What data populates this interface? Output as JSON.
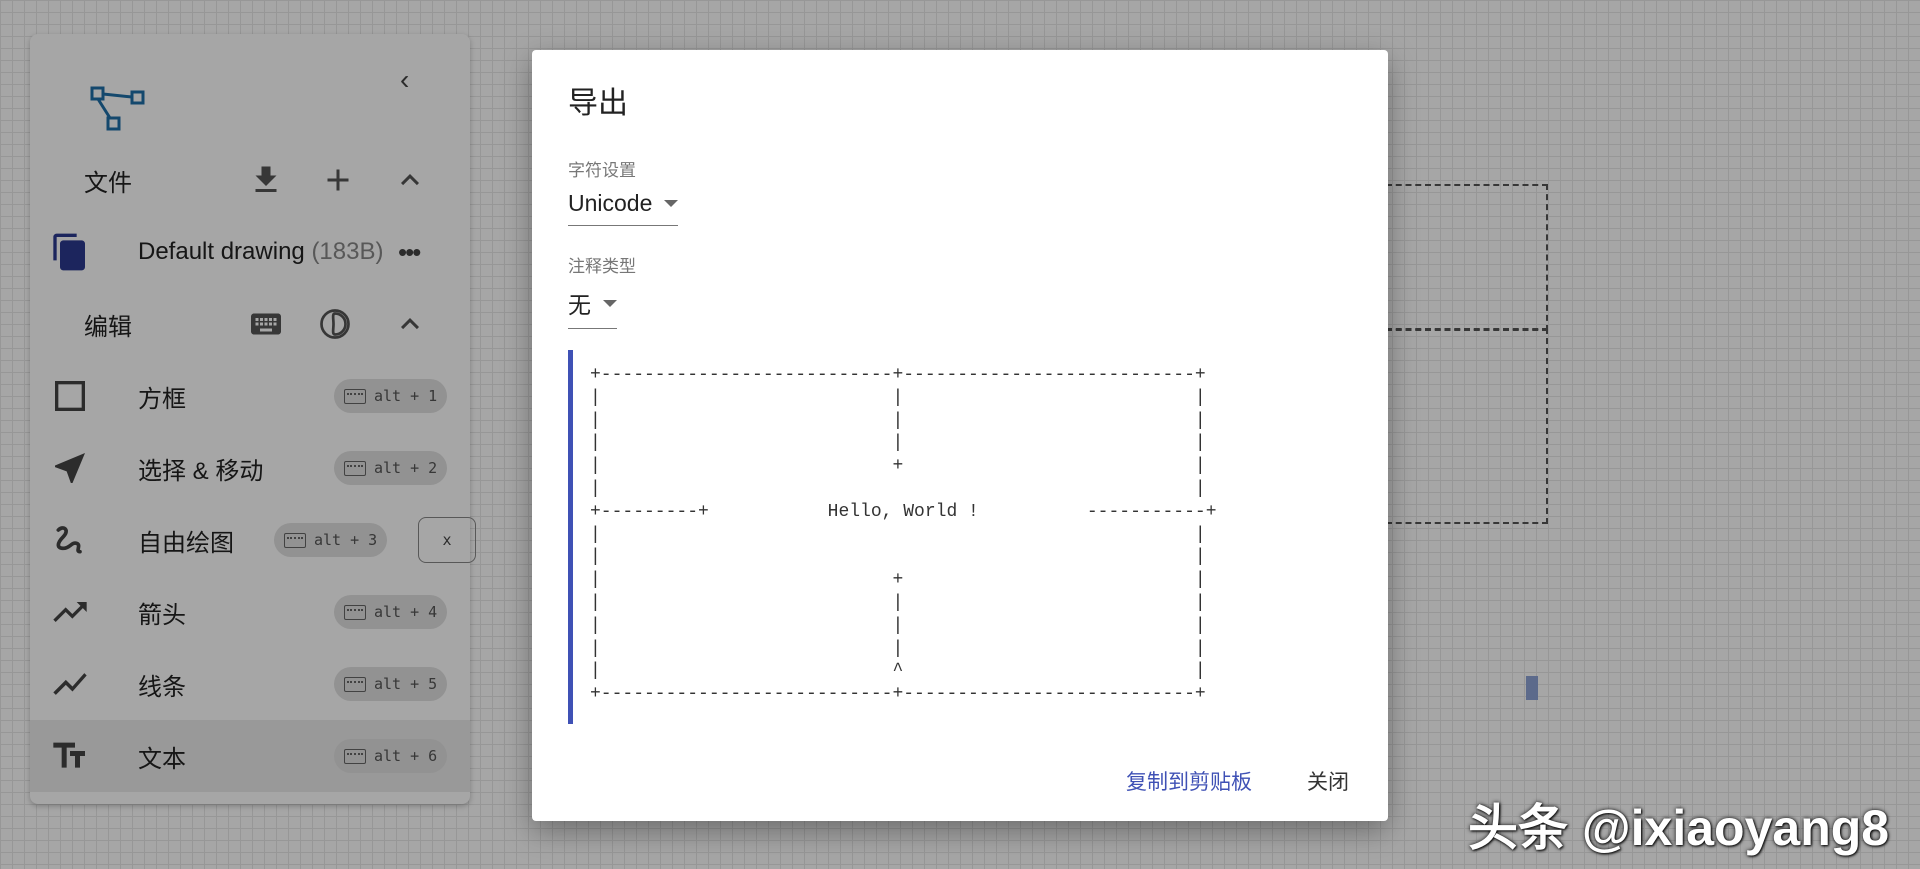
{
  "sidebar": {
    "file_section": {
      "label": "文件"
    },
    "drawing": {
      "name": "Default drawing",
      "size": "(183B)"
    },
    "edit_section": {
      "label": "编辑"
    },
    "tools": [
      {
        "label": "方框",
        "shortcut": "alt + 1",
        "icon": "square-icon"
      },
      {
        "label": "选择 & 移动",
        "shortcut": "alt + 2",
        "icon": "navigation-arrow-icon"
      },
      {
        "label": "自由绘图",
        "shortcut": "alt + 3",
        "extra_key": "x",
        "icon": "freehand-icon"
      },
      {
        "label": "箭头",
        "shortcut": "alt + 4",
        "icon": "trend-arrow-icon"
      },
      {
        "label": "线条",
        "shortcut": "alt + 5",
        "icon": "line-chart-icon"
      },
      {
        "label": "文本",
        "shortcut": "alt + 6",
        "icon": "text-icon",
        "active": true
      }
    ]
  },
  "dialog": {
    "title": "导出",
    "charset": {
      "label": "字符设置",
      "value": "Unicode"
    },
    "comment_type": {
      "label": "注释类型",
      "value": "无"
    },
    "preview_text": "+---------------------------+---------------------------+\n|                           |                           |\n|                           |                           |\n|                           |                           |\n|                           +                           |\n|                                                       |\n+---------+           Hello, World !          -----------+\n|                                                       |\n|                                                       |\n|                           +                           |\n|                           |                           |\n|                           |                           |\n|                           |                           |\n|                           ^                           |\n+---------------------------+---------------------------+",
    "copy_label": "复制到剪贴板",
    "close_label": "关闭"
  },
  "watermark": "头条 @ixiaoyang8",
  "colors": {
    "accent": "#3f51b5",
    "logo": "#1f6fa8",
    "overlay": "rgba(0,0,0,0.35)"
  }
}
